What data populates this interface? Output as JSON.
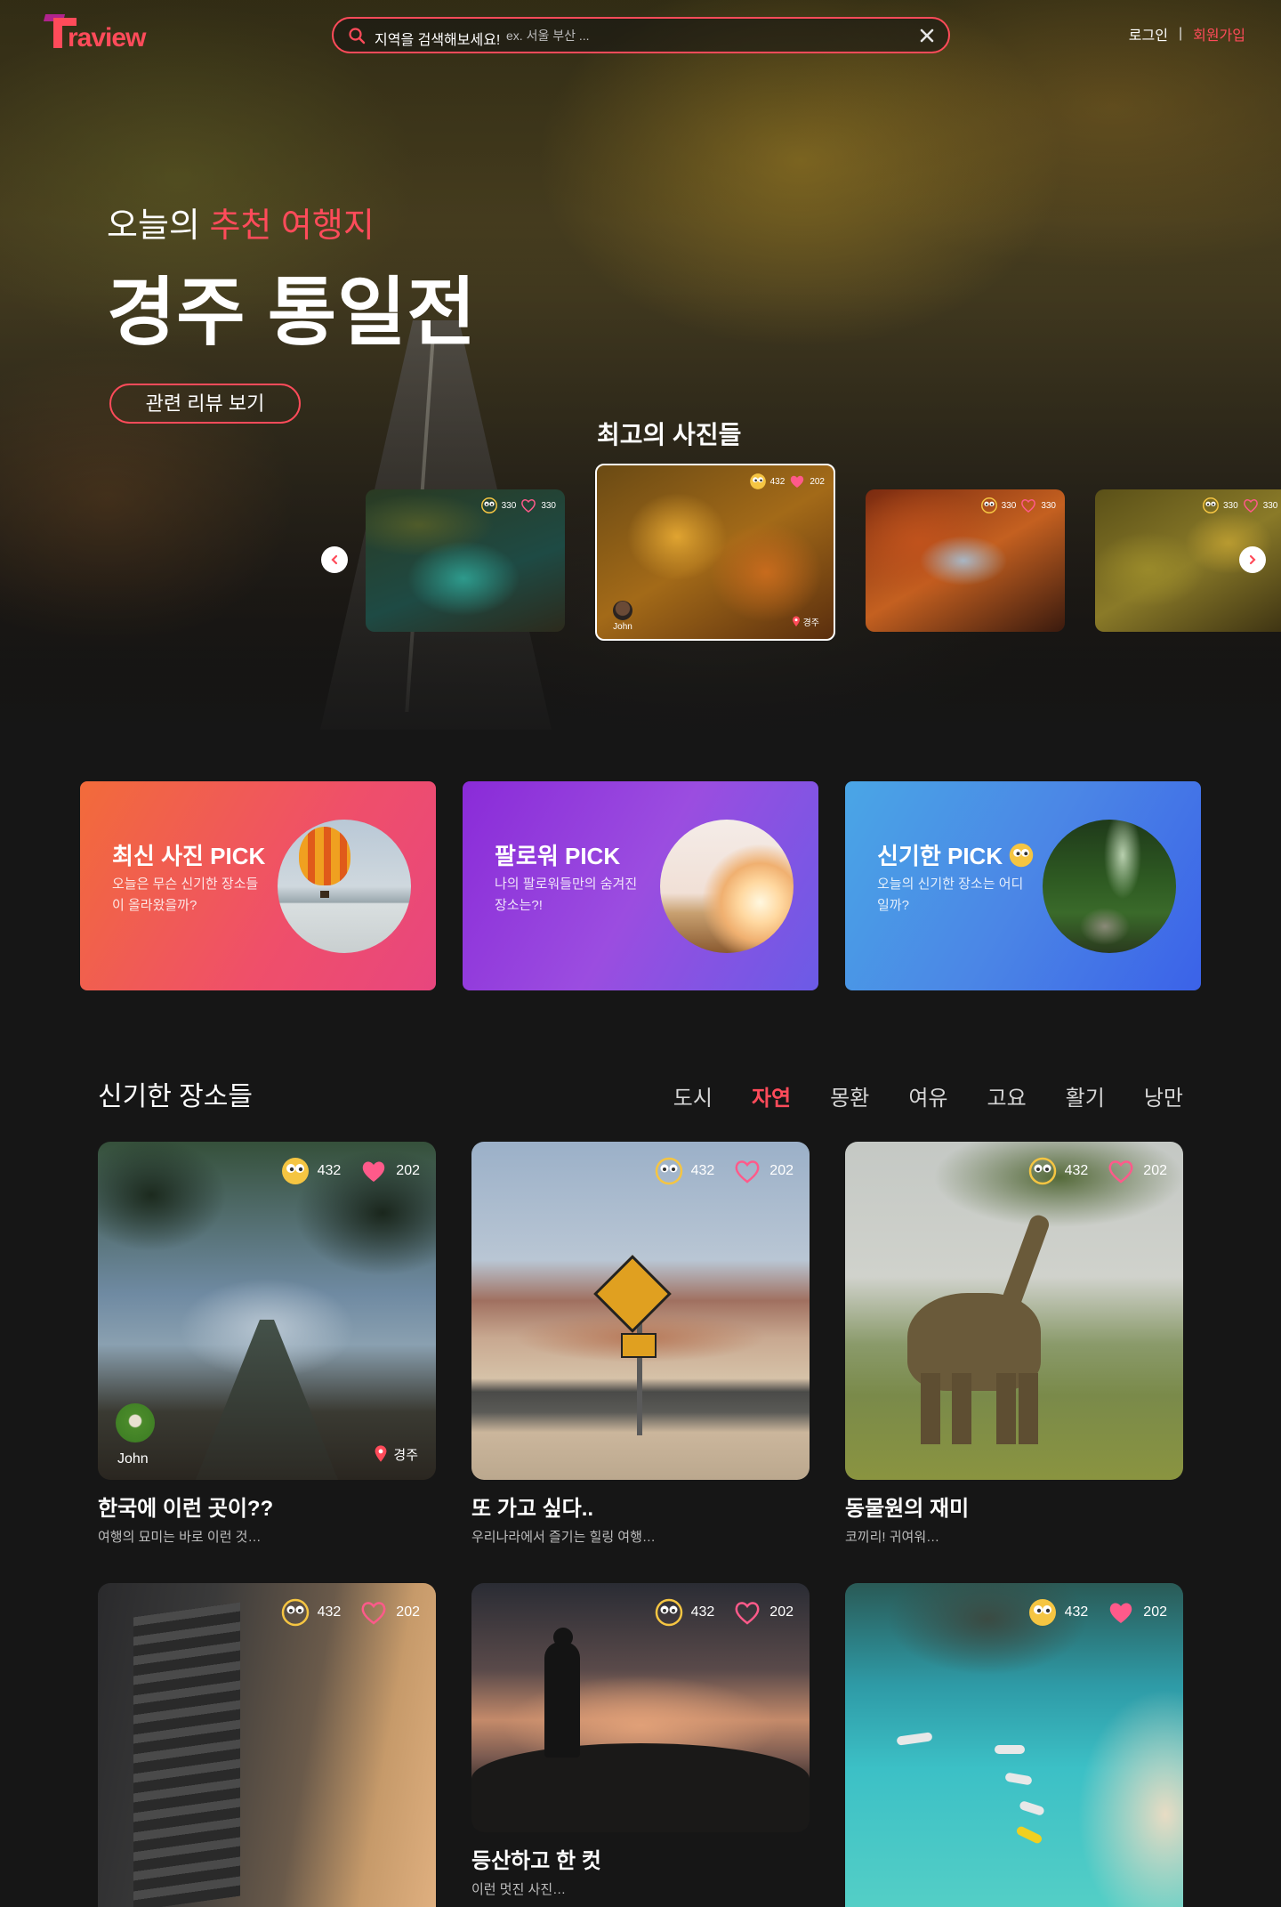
{
  "header": {
    "logo_text": "raview",
    "search": {
      "label": "지역을 검색해보세요!",
      "placeholder": "ex. 서울 부산 ..."
    },
    "login": "로그인",
    "separator": "|",
    "signup": "회원가입"
  },
  "hero": {
    "subtitle_prefix": "오늘의",
    "subtitle_accent": "추천 여행지",
    "title": "경주 통일전",
    "button": "관련 리뷰 보기"
  },
  "best_photos": {
    "title": "최고의 사진들",
    "cards": [
      {
        "eyes": "330",
        "likes": "330"
      },
      {
        "eyes": "432",
        "likes": "202",
        "author": "John",
        "place": "경주"
      },
      {
        "eyes": "330",
        "likes": "330"
      },
      {
        "eyes": "330",
        "likes": "330"
      }
    ]
  },
  "picks": [
    {
      "title": "최신 사진 PICK",
      "desc": "오늘은 무슨 신기한 장소들이 올라왔을까?"
    },
    {
      "title": "팔로워 PICK",
      "desc": "나의 팔로워들만의 숨겨진 장소는?!"
    },
    {
      "title": "신기한 PICK",
      "desc": "오늘의 신기한 장소는 어디일까?"
    }
  ],
  "section": {
    "title": "신기한 장소들",
    "tabs": [
      "도시",
      "자연",
      "몽환",
      "여유",
      "고요",
      "활기",
      "낭만"
    ],
    "active_tab": "자연"
  },
  "cards": [
    {
      "eyes": "432",
      "likes": "202",
      "title": "한국에 이런 곳이??",
      "desc": "여행의 묘미는 바로 이런 것…",
      "author": "John",
      "place": "경주"
    },
    {
      "eyes": "432",
      "likes": "202",
      "title": "또 가고 싶다..",
      "desc": "우리나라에서 즐기는 힐링 여행…"
    },
    {
      "eyes": "432",
      "likes": "202",
      "title": "동물원의 재미",
      "desc": "코끼리! 귀여워…"
    },
    {
      "eyes": "432",
      "likes": "202",
      "title": "",
      "desc": ""
    },
    {
      "eyes": "432",
      "likes": "202",
      "title": "등산하고 한 컷",
      "desc": "이런 멋진 사진…"
    },
    {
      "eyes": "432",
      "likes": "202",
      "title": "",
      "desc": ""
    }
  ],
  "colors": {
    "accent": "#ff4b5a",
    "background": "#161616",
    "heart": "#ff5a8a",
    "emoji": "#f5c542"
  },
  "icons": [
    "search-icon",
    "clear-icon",
    "eyes-emoji-icon",
    "heart-icon",
    "location-pin-icon",
    "chevron-left-icon",
    "chevron-right-icon"
  ]
}
